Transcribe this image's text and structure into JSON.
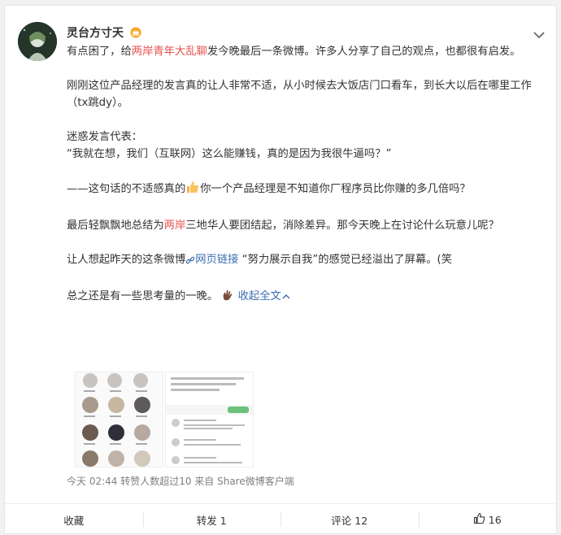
{
  "post": {
    "username": "灵台方寸天",
    "crown_icon": "crown-icon",
    "menu_icon": "chevron-down-icon",
    "p1": {
      "a": "有点困了，给",
      "link": "两岸青年大乱聊",
      "b": "发今晚最后一条微博。许多人分享了自己的观点，也都很有启发。"
    },
    "p2": "刚刚这位产品经理的发言真的让人非常不适，从小时候去大饭店门口看车，到长大以后在哪里工作（tx跳dy）。",
    "p3_line1": "迷惑发言代表：",
    "p3_line2": "“我就在想，我们（互联网）这么能赚钱，真的是因为我很牛逼吗？”",
    "p4": {
      "a": "——这句话的不适感真的",
      "b": "你一个产品经理是不知道你厂程序员比你赚的多几倍吗？",
      "emoji": "thumbs-up-icon"
    },
    "p5": {
      "a": "最后轻飘飘地总结为",
      "link": "两岸",
      "b": "三地华人要团结起，消除差异。那今天晚上在讨论什么玩意儿呢？"
    },
    "p6": {
      "a": "让人想起昨天的这条微博",
      "link": "网页链接",
      "b": " “努力展示自我”的感觉已经溢出了屏幕。(笑"
    },
    "p7": {
      "a": "总之还是有一些思考量的一晚。",
      "collapse": "收起全文",
      "emoji": "waving-hand-icon"
    },
    "meta": "今天 02:44 转赞人数超过10  来自 Share微博客户端"
  },
  "actions": {
    "favorite": "收藏",
    "repost": "转发 1",
    "comment": "评论 12",
    "like": "16"
  },
  "colors": {
    "accent": "#eb7350",
    "link_blue": "#3b6db3"
  }
}
